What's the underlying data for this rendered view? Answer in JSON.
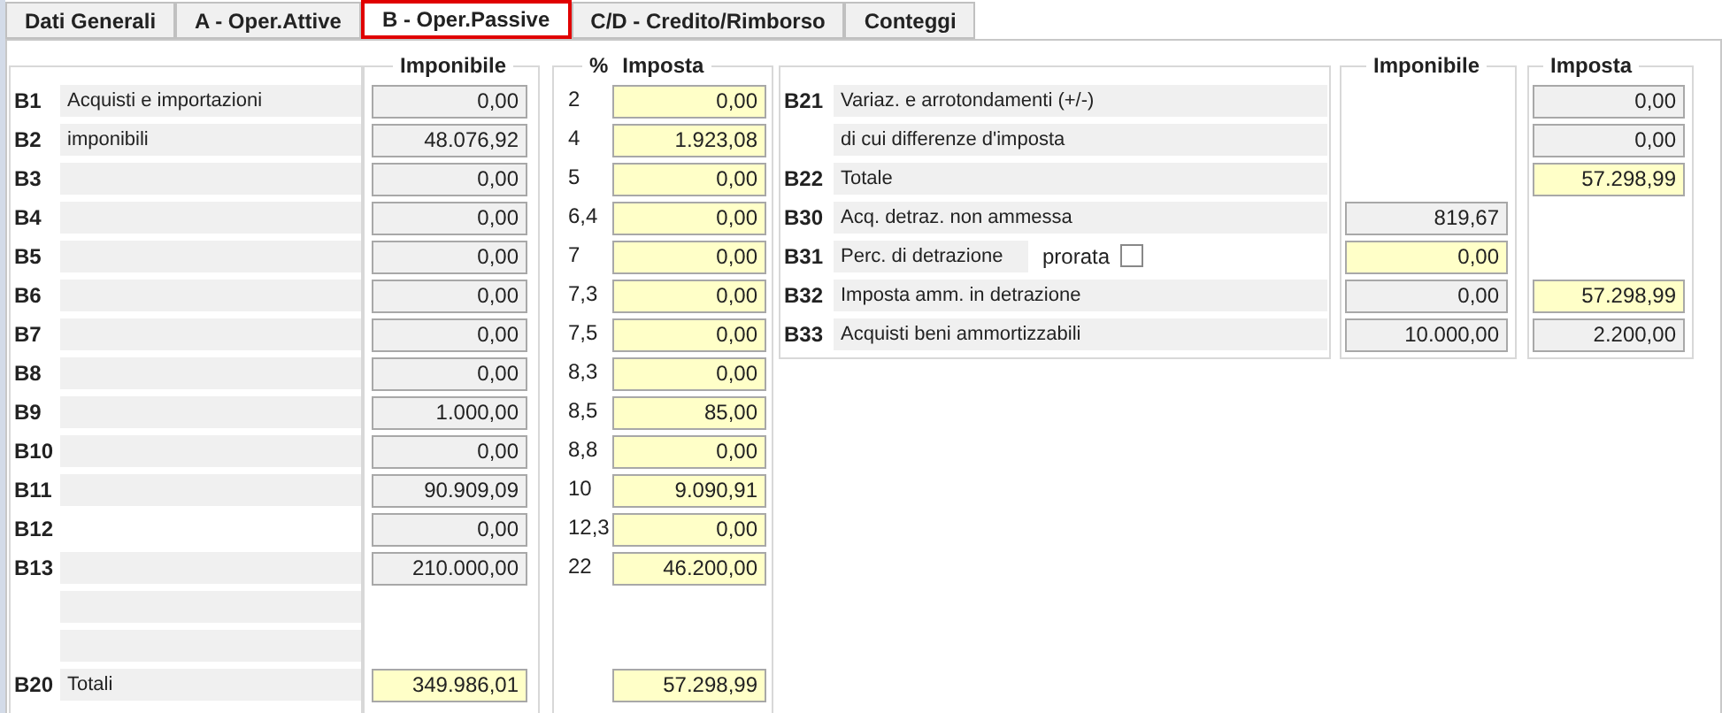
{
  "tabs": [
    {
      "label": "Dati Generali",
      "selected": false
    },
    {
      "label": "A - Oper.Attive",
      "selected": false
    },
    {
      "label": "B - Oper.Passive",
      "selected": true
    },
    {
      "label": "C/D - Credito/Rimborso",
      "selected": false
    },
    {
      "label": "Conteggi",
      "selected": false
    }
  ],
  "left_section": {
    "imponibile_header": "Imponibile",
    "rate_header": "%",
    "imposta_header": "Imposta",
    "rows": [
      {
        "code": "B1",
        "label": "Acquisti e importazioni",
        "label_field": true,
        "imponibile": {
          "value": "0,00",
          "editable": false
        },
        "rate": "2",
        "imposta": {
          "value": "0,00",
          "editable": true
        }
      },
      {
        "code": "B2",
        "label": "imponibili",
        "label_field": true,
        "imponibile": {
          "value": "48.076,92",
          "editable": false
        },
        "rate": "4",
        "imposta": {
          "value": "1.923,08",
          "editable": true
        }
      },
      {
        "code": "B3",
        "label_field": true,
        "imponibile": {
          "value": "0,00",
          "editable": false
        },
        "rate": "5",
        "imposta": {
          "value": "0,00",
          "editable": true
        }
      },
      {
        "code": "B4",
        "label_field": true,
        "imponibile": {
          "value": "0,00",
          "editable": false
        },
        "rate": "6,4",
        "imposta": {
          "value": "0,00",
          "editable": true
        }
      },
      {
        "code": "B5",
        "label_field": true,
        "imponibile": {
          "value": "0,00",
          "editable": false
        },
        "rate": "7",
        "imposta": {
          "value": "0,00",
          "editable": true
        }
      },
      {
        "code": "B6",
        "label_field": true,
        "imponibile": {
          "value": "0,00",
          "editable": false
        },
        "rate": "7,3",
        "imposta": {
          "value": "0,00",
          "editable": true
        }
      },
      {
        "code": "B7",
        "label_field": true,
        "imponibile": {
          "value": "0,00",
          "editable": false
        },
        "rate": "7,5",
        "imposta": {
          "value": "0,00",
          "editable": true
        }
      },
      {
        "code": "B8",
        "label_field": true,
        "imponibile": {
          "value": "0,00",
          "editable": false
        },
        "rate": "8,3",
        "imposta": {
          "value": "0,00",
          "editable": true
        }
      },
      {
        "code": "B9",
        "label_field": true,
        "imponibile": {
          "value": "1.000,00",
          "editable": false
        },
        "rate": "8,5",
        "imposta": {
          "value": "85,00",
          "editable": true
        }
      },
      {
        "code": "B10",
        "label_field": true,
        "imponibile": {
          "value": "0,00",
          "editable": false
        },
        "rate": "8,8",
        "imposta": {
          "value": "0,00",
          "editable": true
        }
      },
      {
        "code": "B11",
        "label_field": true,
        "imponibile": {
          "value": "90.909,09",
          "editable": false
        },
        "rate": "10",
        "imposta": {
          "value": "9.090,91",
          "editable": true
        }
      },
      {
        "code": "B12",
        "label_field": false,
        "imponibile": {
          "value": "0,00",
          "editable": false
        },
        "rate": "12,3",
        "imposta": {
          "value": "0,00",
          "editable": true
        }
      },
      {
        "code": "B13",
        "label_field": true,
        "imponibile": {
          "value": "210.000,00",
          "editable": false
        },
        "rate": "22",
        "imposta": {
          "value": "46.200,00",
          "editable": true
        }
      },
      {
        "label_field": true
      },
      {
        "label_field": true
      },
      {
        "code": "B20",
        "label": "Totali",
        "label_field": true,
        "imponibile": {
          "value": "349.986,01",
          "editable": true
        },
        "imposta": {
          "value": "57.298,99",
          "editable": true
        }
      }
    ]
  },
  "right_section": {
    "imponibile_header": "Imponibile",
    "imposta_header": "Imposta",
    "rows": [
      {
        "code": "B21",
        "label": "Variaz. e arrotondamenti (+/-)",
        "imposta": {
          "value": "0,00",
          "editable": false
        }
      },
      {
        "label": "di cui differenze d'imposta",
        "imposta": {
          "value": "0,00",
          "editable": false
        }
      },
      {
        "code": "B22",
        "label": "Totale",
        "imposta": {
          "value": "57.298,99",
          "editable": true
        }
      },
      {
        "code": "B30",
        "label": "Acq. detraz. non ammessa",
        "imponibile": {
          "value": "819,67",
          "editable": false
        }
      },
      {
        "code": "B31",
        "label": "Perc. di detrazione",
        "prorata": {
          "label": "prorata",
          "checked": false
        },
        "imponibile": {
          "value": "0,00",
          "editable": true
        }
      },
      {
        "code": "B32",
        "label": "Imposta amm. in detrazione",
        "imponibile": {
          "value": "0,00",
          "editable": false
        },
        "imposta": {
          "value": "57.298,99",
          "editable": true
        }
      },
      {
        "code": "B33",
        "label": "Acquisti beni ammortizzabili",
        "imponibile": {
          "value": "10.000,00",
          "editable": false
        },
        "imposta": {
          "value": "2.200,00",
          "editable": false
        }
      }
    ]
  }
}
